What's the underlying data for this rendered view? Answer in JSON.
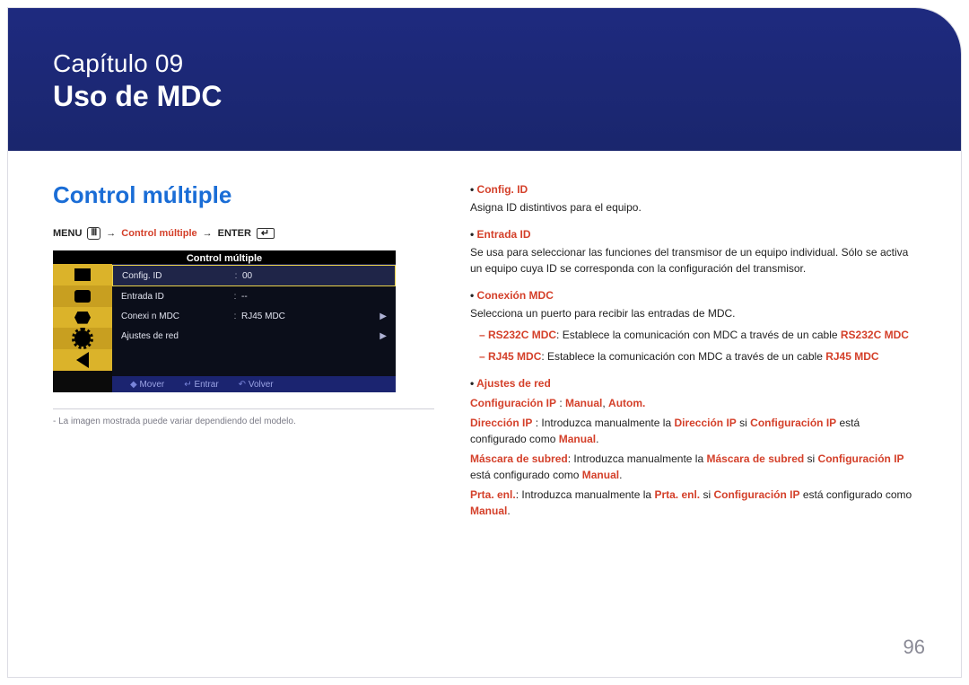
{
  "header": {
    "chapter": "Capítulo 09",
    "title": "Uso de MDC"
  },
  "page_number": "96",
  "section": {
    "heading": "Control múltiple"
  },
  "path": {
    "menu": "MENU",
    "arrow": "→",
    "item": "Control múltiple",
    "enter": "ENTER"
  },
  "osd": {
    "title": "Control múltiple",
    "rows": [
      {
        "label": "Config. ID",
        "value": "00",
        "arrow": ""
      },
      {
        "label": "Entrada ID",
        "value": "--",
        "arrow": ""
      },
      {
        "label": "Conexi n MDC",
        "value": "RJ45 MDC",
        "arrow": "▶"
      },
      {
        "label": "Ajustes de red",
        "value": "",
        "arrow": "▶"
      }
    ],
    "footer": {
      "move": "Mover",
      "enter": "Entrar",
      "back": "Volver"
    }
  },
  "figure_note": "La imagen mostrada puede variar dependiendo del modelo.",
  "bullets": {
    "config_id": {
      "label": "Config. ID",
      "text": "Asigna ID distintivos para el equipo."
    },
    "entrada_id": {
      "label": "Entrada ID",
      "text": "Se usa para seleccionar las funciones del transmisor de un equipo individual. Sólo se activa un equipo cuya ID se corresponda con la configuración del transmisor."
    },
    "conexion": {
      "label": "Conexión MDC",
      "text": "Selecciona un puerto para recibir las entradas de MDC.",
      "rs": {
        "name": "RS232C MDC",
        "desc": ": Establece la comunicación con MDC a través de un cable ",
        "via": "RS232C MDC"
      },
      "rj": {
        "name": "RJ45 MDC",
        "desc": ": Establece la comunicación con MDC a través de un cable ",
        "via": "RJ45 MDC"
      }
    },
    "ajustes": {
      "label": "Ajustes de red",
      "ipconf_label": "Configuración IP",
      "ipconf_sep": " : ",
      "ipconf_v1": "Manual",
      "ipconf_comma": ", ",
      "ipconf_v2": "Autom.",
      "dir": {
        "name": "Dirección IP",
        "lead": " : Introduzca manualmente la ",
        "field": "Dirección IP",
        "mid": " si ",
        "conf": "Configuración IP",
        "tail": " está configurado como ",
        "manual": "Manual"
      },
      "mask": {
        "name": "Máscara de subred",
        "lead": ": Introduzca manualmente la ",
        "field": "Máscara de subred",
        "mid": " si ",
        "conf": "Configuración IP",
        "tail": " está configurado como ",
        "manual": "Manual"
      },
      "gw": {
        "name": "Prta. enl.",
        "lead": ": Introduzca manualmente la ",
        "field": "Prta. enl.",
        "mid": " si ",
        "conf": "Configuración IP",
        "tail": " está configurado como ",
        "manual": "Manual"
      }
    }
  }
}
